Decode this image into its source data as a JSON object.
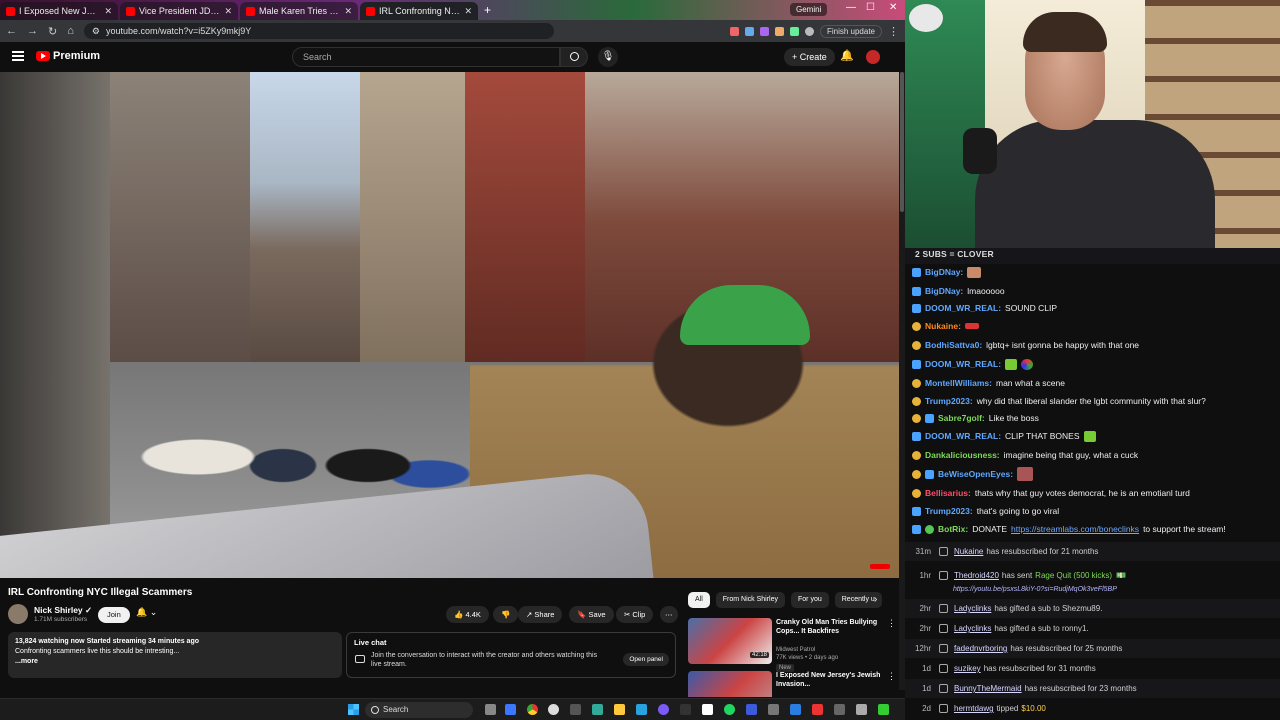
{
  "browser": {
    "tabs": [
      {
        "label": "I Exposed New Jersey's Jewish"
      },
      {
        "label": "Vice President JD Vance Delive"
      },
      {
        "label": "Male Karen Tries Bullying Offic"
      },
      {
        "label": "IRL Confronting NYC Illegal Sc"
      }
    ],
    "gemini_label": "Gemini",
    "url": "youtube.com/watch?v=i5ZKy9mkj9Y",
    "finish_update": "Finish update"
  },
  "youtube": {
    "brand": "Premium",
    "search_placeholder": "Search",
    "create_label": "Create",
    "video_title": "IRL Confronting NYC Illegal Scammers",
    "channel_name": "Nick Shirley",
    "channel_subs": "1.71M subscribers",
    "join_label": "Join",
    "likes": "4.4K",
    "share_label": "Share",
    "save_label": "Save",
    "clip_label": "Clip",
    "desc_stats": "13,824 watching now  Started streaming 34 minutes ago",
    "desc_text": "Confronting scammers live this should be intresting...",
    "desc_more": "...more",
    "live_chat_title": "Live chat",
    "live_chat_text": "Join the conversation to interact with the creator and others watching this live stream.",
    "open_panel": "Open panel",
    "chips": [
      "All",
      "From Nick Shirley",
      "For you",
      "Recently u"
    ],
    "recs": [
      {
        "title": "Cranky Old Man Tries Bullying Cops... It Backfires",
        "channel": "Midwest Patrol",
        "meta": "77K views • 2 days ago",
        "badge": "New",
        "duration": "42:18"
      },
      {
        "title": "I Exposed New Jersey's Jewish Invasion...",
        "channel": "",
        "meta": "",
        "badge": "",
        "duration": ""
      }
    ]
  },
  "chat": {
    "subs_banner": "2 SUBS = CLOVER",
    "messages": [
      {
        "user": "BigDNay:",
        "text": "",
        "color": "#5fa8ff"
      },
      {
        "user": "BigDNay:",
        "text": "lmaooooo",
        "color": "#5fa8ff"
      },
      {
        "user": "DOOM_WR_REAL:",
        "text": "SOUND CLIP",
        "color": "#5fa8ff"
      },
      {
        "user": "Nukaine:",
        "text": "",
        "color": "#ff8a1e"
      },
      {
        "user": "BodhiSattva0:",
        "text": "lgbtq+ isnt gonna be happy with that one",
        "color": "#5fa8ff"
      },
      {
        "user": "DOOM_WR_REAL:",
        "text": "",
        "color": "#5fa8ff"
      },
      {
        "user": "MontellWilliams:",
        "text": "man what a scene",
        "color": "#5fa8ff"
      },
      {
        "user": "Trump2023:",
        "text": "why did that liberal slander the lgbt community with that slur?",
        "color": "#5fa8ff"
      },
      {
        "user": "Sabre7golf:",
        "text": "Like the boss",
        "color": "#7fd95a"
      },
      {
        "user": "DOOM_WR_REAL:",
        "text": "CLIP THAT BONES",
        "color": "#5fa8ff"
      },
      {
        "user": "Dankaliciousness:",
        "text": "imagine being that guy, what a cuck",
        "color": "#7fd95a"
      },
      {
        "user": "BeWiseOpenEyes:",
        "text": "",
        "color": "#5fa8ff"
      },
      {
        "user": "Bellisarius:",
        "text": "thats why that guy votes democrat, he is an emotianl turd",
        "color": "#ff4d6a"
      },
      {
        "user": "Trump2023:",
        "text": "that's going to go viral",
        "color": "#5fa8ff"
      },
      {
        "user": "BotRix:",
        "text": "DONATE",
        "link": "https://streamlabs.com/boneclinks",
        "tail": "to support the stream!",
        "color": "#7fd95a"
      }
    ],
    "events": [
      {
        "time": "31m",
        "user": "Nukaine",
        "text": "has resubscribed for 21 months"
      },
      {
        "time": "1hr",
        "user": "Thedroid420",
        "text": "has sent",
        "highlight": "Rage Quit (500 kicks)"
      },
      {
        "time": "2hr",
        "user": "Ladyclinks",
        "text": "has gifted a sub to Shezmu89."
      },
      {
        "time": "2hr",
        "user": "Ladyclinks",
        "text": "has gifted a sub to ronny1."
      },
      {
        "time": "12hr",
        "user": "fadednvrboring",
        "text": "has resubscribed for 25 months"
      },
      {
        "time": "1d",
        "user": "suzikey",
        "text": "has resubscribed for 31 months"
      },
      {
        "time": "1d",
        "user": "BunnyTheMermaid",
        "text": "has resubscribed for 23 months"
      },
      {
        "time": "2d",
        "user": "hermtdawg",
        "text": "tipped",
        "highlight": "$10.00"
      }
    ],
    "event_link": "https://youtu.be/psxsL8kiY-0?si=RudjMqOk3veFl5BP"
  },
  "taskbar": {
    "search_label": "Search"
  },
  "colors": {
    "accent_red": "#ff0000",
    "chat_bg": "#0f0f10",
    "yt_bg": "#0f0f0f"
  }
}
